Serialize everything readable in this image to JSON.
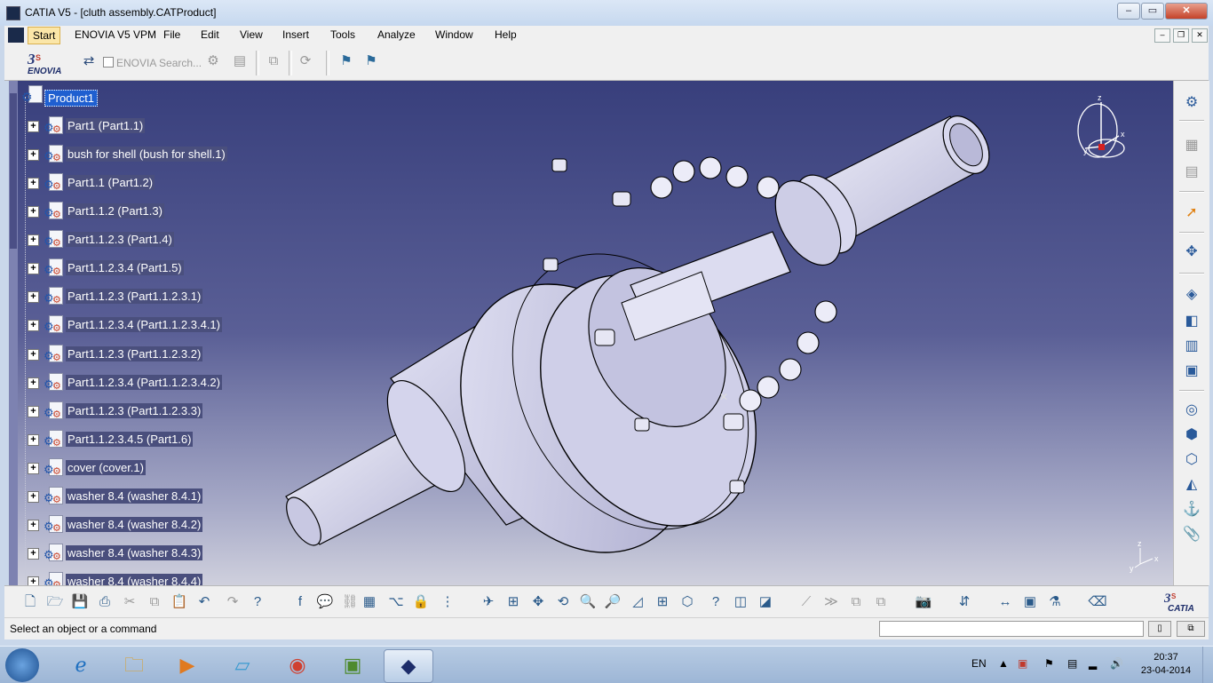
{
  "window": {
    "title": "CATIA V5 - [cluth assembly.CATProduct]",
    "controls": {
      "minimize": "–",
      "maximize": "▭",
      "close": "✕"
    },
    "mdi_controls": {
      "minimize": "–",
      "restore": "❐",
      "close": "✕"
    }
  },
  "menubar": {
    "items": [
      "Start",
      "ENOVIA V5 VPM",
      "File",
      "Edit",
      "View",
      "Insert",
      "Tools",
      "Analyze",
      "Window",
      "Help"
    ]
  },
  "toolbar": {
    "enovia_logo": "ENOVIA",
    "enovia_search": "ENOVIA Search...",
    "icons": [
      "enovia-connect-icon",
      "enovia-search-checkbox",
      "search-settings-icon",
      "save-to-db-icon",
      "load-icon",
      "refresh-icon",
      "flag-icon-1",
      "flag-icon-2"
    ]
  },
  "tree": {
    "root": "Product1",
    "nodes": [
      "Part1 (Part1.1)",
      "bush for shell (bush for shell.1)",
      "Part1.1 (Part1.2)",
      "Part1.1.2 (Part1.3)",
      "Part1.1.2.3 (Part1.4)",
      "Part1.1.2.3.4 (Part1.5)",
      "Part1.1.2.3 (Part1.1.2.3.1)",
      "Part1.1.2.3.4 (Part1.1.2.3.4.1)",
      "Part1.1.2.3 (Part1.1.2.3.2)",
      "Part1.1.2.3.4 (Part1.1.2.3.4.2)",
      "Part1.1.2.3 (Part1.1.2.3.3)",
      "Part1.1.2.3.4.5 (Part1.6)",
      "cover (cover.1)",
      "washer 8.4 (washer 8.4.1)",
      "washer 8.4 (washer 8.4.2)",
      "washer 8.4 (washer 8.4.3)",
      "washer 8.4 (washer 8.4.4)"
    ]
  },
  "compass": {
    "x": "x",
    "y": "y",
    "z": "z"
  },
  "axis_triad": {
    "x": "x",
    "y": "y",
    "z": "z"
  },
  "catia_logo": "CATIA",
  "statusbar": {
    "message": "Select an object or a command"
  },
  "taskbar": {
    "lang": "EN",
    "time": "20:37",
    "date": "23-04-2014"
  },
  "colors": {
    "viewport_top": "#383f7c",
    "viewport_bottom": "#cfd0dd",
    "part_fill": "#d9d9f0",
    "selection": "#1f5fd0"
  }
}
